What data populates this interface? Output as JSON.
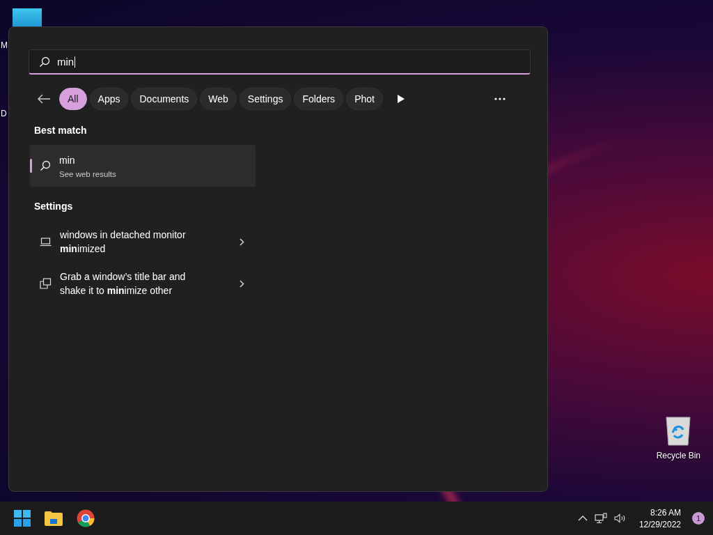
{
  "desktop": {
    "cut_labels": [
      "M",
      "D"
    ],
    "recycle_bin": {
      "label": "Recycle Bin"
    }
  },
  "search": {
    "value": "min"
  },
  "filters": [
    {
      "label": "All",
      "selected": true
    },
    {
      "label": "Apps",
      "selected": false
    },
    {
      "label": "Documents",
      "selected": false
    },
    {
      "label": "Web",
      "selected": false
    },
    {
      "label": "Settings",
      "selected": false
    },
    {
      "label": "Folders",
      "selected": false
    },
    {
      "label": "Phot",
      "selected": false
    }
  ],
  "sections": [
    {
      "heading": "Best match",
      "items": [
        {
          "kind": "web",
          "title": "min",
          "subtitle": "See web results",
          "selected": true
        }
      ]
    },
    {
      "heading": "Settings",
      "items": [
        {
          "kind": "display",
          "title": "windows in detached monitor **min**imized",
          "selected": false
        },
        {
          "kind": "windows",
          "title": "Grab a window’s title bar and shake it to **min**imize other",
          "selected": false
        }
      ]
    }
  ],
  "taskbar": {
    "apps": [
      {
        "kind": "start"
      },
      {
        "kind": "explorer"
      },
      {
        "kind": "chrome"
      }
    ],
    "time": "8:26 AM",
    "date": "12/29/2022",
    "notification_count": "1"
  }
}
